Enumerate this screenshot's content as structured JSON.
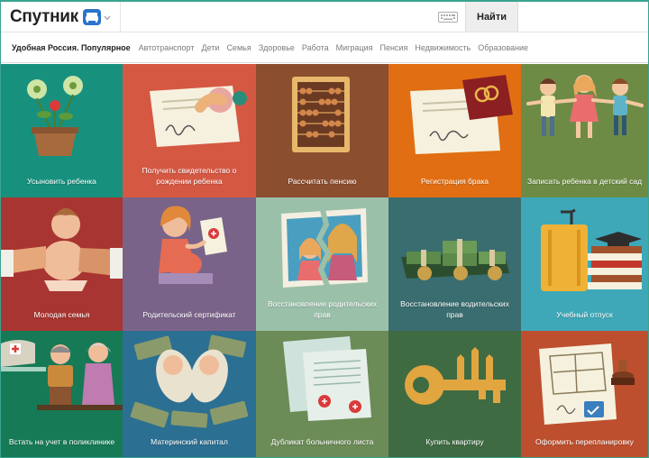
{
  "header": {
    "logo_text": "Спутник",
    "search_value": "",
    "search_button": "Найти"
  },
  "nav": {
    "title": "Удобная Россия. Популярное",
    "links": [
      "Автотранспорт",
      "Дети",
      "Семья",
      "Здоровье",
      "Работа",
      "Миграция",
      "Пенсия",
      "Недвижимость",
      "Образование"
    ]
  },
  "tiles": [
    {
      "label": "Усыновить ребенка",
      "bg": "#17917e"
    },
    {
      "label": "Получить свидетельство о рождении ребенка",
      "bg": "#d55843"
    },
    {
      "label": "Рассчитать пенсию",
      "bg": "#8b4e2f"
    },
    {
      "label": "Регистрация брака",
      "bg": "#e16e12"
    },
    {
      "label": "Записать ребенка в детский сад",
      "bg": "#6e8b45"
    },
    {
      "label": "Молодая семья",
      "bg": "#a83531"
    },
    {
      "label": "Родительский сертификат",
      "bg": "#7a6389"
    },
    {
      "label": "Восстановление родительских прав",
      "bg": "#9bc0aa"
    },
    {
      "label": "Восстановление водительских прав",
      "bg": "#3a6d70"
    },
    {
      "label": "Учебный отпуск",
      "bg": "#3ea8b8"
    },
    {
      "label": "Встать на учет в поликлинике",
      "bg": "#177a57"
    },
    {
      "label": "Материнский капитал",
      "bg": "#2b6f92"
    },
    {
      "label": "Дубликат больничного листа",
      "bg": "#6b8b57"
    },
    {
      "label": "Купить квартиру",
      "bg": "#3f6b43"
    },
    {
      "label": "Оформить перепланировку",
      "bg": "#bd4f2e"
    }
  ]
}
